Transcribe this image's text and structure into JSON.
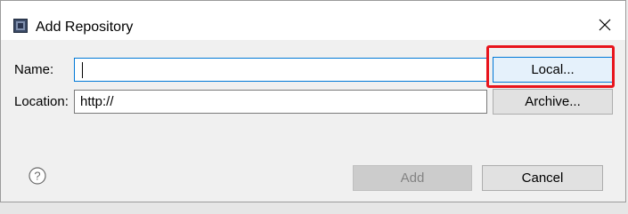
{
  "window": {
    "title": "Add Repository",
    "close_icon": "close-icon",
    "app_icon": "repository-app-icon"
  },
  "form": {
    "name_label": "Name:",
    "name_value": "",
    "location_label": "Location:",
    "location_value": "http://"
  },
  "buttons": {
    "local_label": "Local...",
    "archive_label": "Archive...",
    "add_label": "Add",
    "cancel_label": "Cancel"
  },
  "help_icon": "help-icon",
  "colors": {
    "accent": "#0078d7",
    "highlight": "#e8141c"
  }
}
